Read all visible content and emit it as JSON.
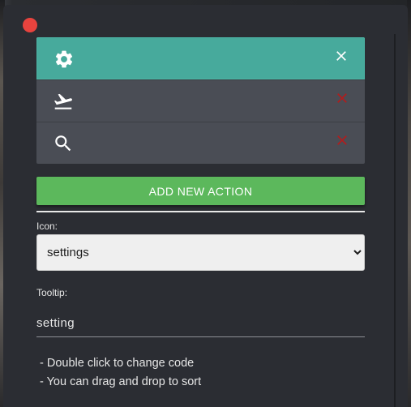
{
  "window": {
    "close_color": "#e8433e"
  },
  "actions": [
    {
      "icon": "gear-icon",
      "active": true,
      "delete_color": "#ffffff"
    },
    {
      "icon": "airplane-takeoff-icon",
      "active": false,
      "delete_color": "#b31c1c"
    },
    {
      "icon": "search-icon",
      "active": false,
      "delete_color": "#b31c1c"
    }
  ],
  "add_button": {
    "label": "ADD NEW ACTION",
    "color": "#5cb85c"
  },
  "icon_field": {
    "label": "Icon:",
    "selected": "settings",
    "options": [
      "settings"
    ]
  },
  "tooltip_field": {
    "label": "Tooltip:",
    "value": "setting"
  },
  "help": {
    "line1": "- Double click to change code",
    "line2": "- You can drag and drop to sort"
  },
  "colors": {
    "active_row": "#47aa9c",
    "row": "#4a4d55",
    "panel": "#2b2d33"
  }
}
